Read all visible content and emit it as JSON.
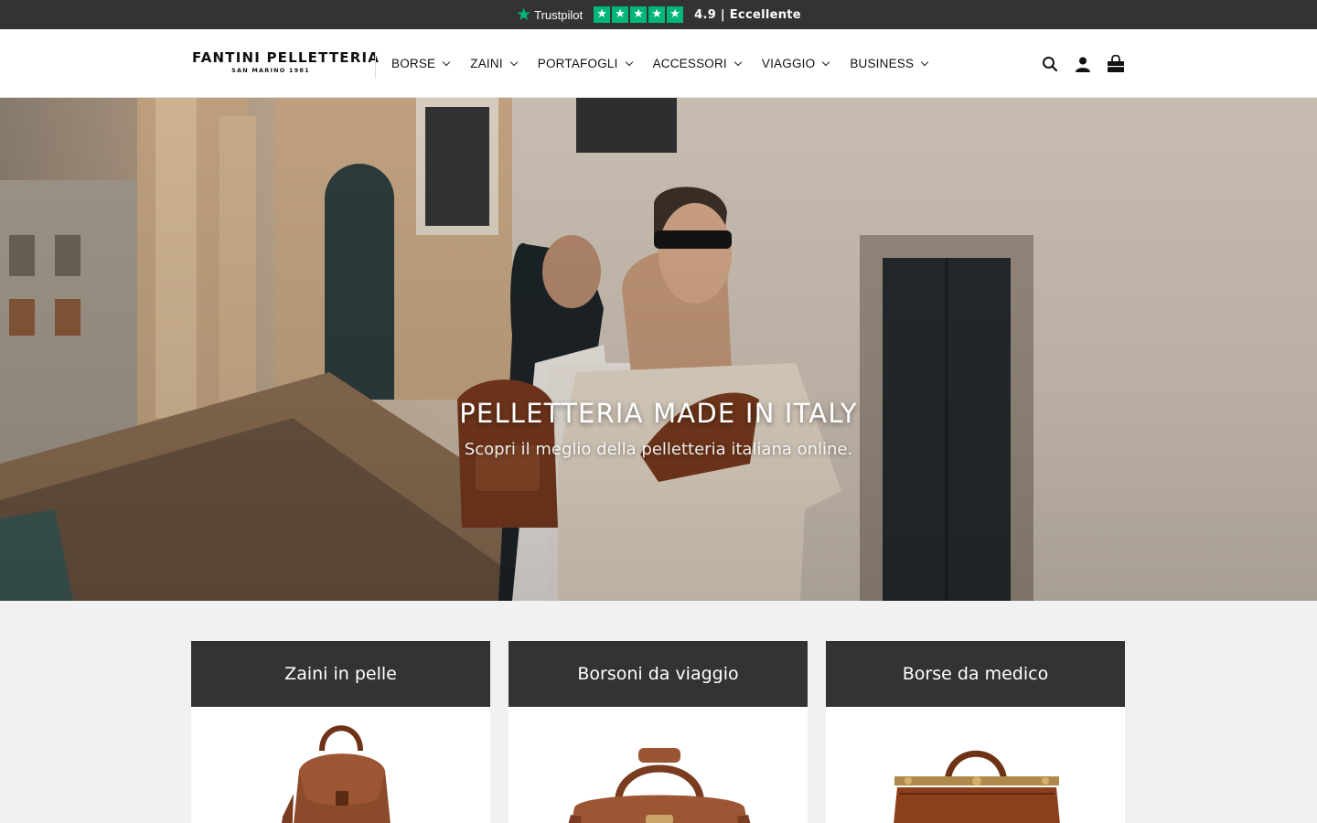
{
  "topbar": {
    "trustpilot_label": "Trustpilot",
    "rating_text": "4.9 | Eccellente",
    "brand_color": "#00b67a"
  },
  "header": {
    "logo_main": "FANTINI PELLETTERIA",
    "logo_sub": "SAN MARINO 1981",
    "nav": [
      {
        "label": "BORSE"
      },
      {
        "label": "ZAINI"
      },
      {
        "label": "PORTAFOGLI"
      },
      {
        "label": "ACCESSORI"
      },
      {
        "label": "VIAGGIO"
      },
      {
        "label": "BUSINESS"
      }
    ],
    "icons": [
      "search-icon",
      "account-icon",
      "cart-icon"
    ]
  },
  "hero": {
    "title": "PELLETTERIA MADE IN ITALY",
    "subtitle": "Scopri il meglio della pelletteria italiana online."
  },
  "categories": [
    {
      "title": "Zaini in pelle"
    },
    {
      "title": "Borsoni da viaggio"
    },
    {
      "title": "Borse da medico"
    }
  ],
  "colors": {
    "dark_bar": "#333333",
    "leather": "#8b4a2a"
  }
}
